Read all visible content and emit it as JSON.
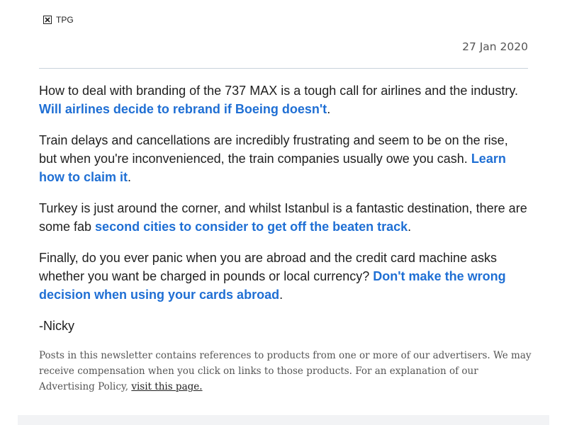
{
  "header": {
    "logo_alt": "TPG",
    "date": "27 Jan 2020"
  },
  "paragraphs": [
    {
      "text": "How to deal with branding of the 737 MAX is a tough call for airlines and the industry. ",
      "link": "Will airlines decide to rebrand if Boeing doesn't",
      "after": "."
    },
    {
      "text": "Train delays and cancellations are incredibly frustrating and seem to be on the rise, but when you're inconvenienced, the train companies usually owe you cash. ",
      "link": "Learn how to claim it",
      "after": "."
    },
    {
      "text": "Turkey is just around the corner, and whilst Istanbul is a fantastic destination, there are some fab ",
      "link": "second cities to consider to get off the beaten track",
      "after": "."
    },
    {
      "text": "Finally, do you ever panic when you are abroad and the credit card machine asks whether you want be charged in pounds or local currency? ",
      "link": "Don't make the wrong decision when using your cards abroad",
      "after": "."
    }
  ],
  "signoff": "-Nicky",
  "disclaimer": {
    "text": "Posts in this newsletter contains references to products from one or more of our advertisers. We may receive compensation when you click on links to those products. For an explanation of our Advertising Policy, ",
    "link": "visit this page."
  },
  "colors": {
    "link": "#1f6fd4",
    "text": "#1f1f1f",
    "muted": "#555555",
    "divider": "#c8d2dc"
  }
}
